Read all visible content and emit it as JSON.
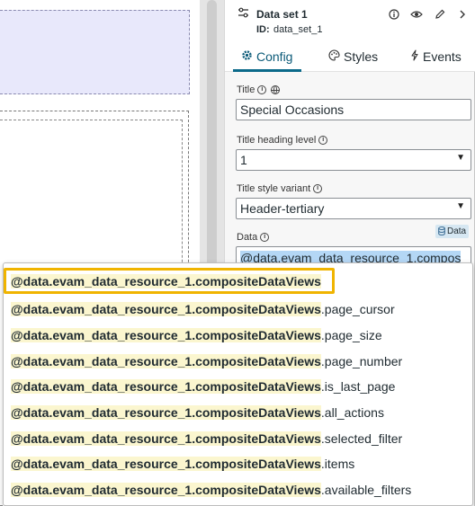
{
  "panel": {
    "header": {
      "title": "Data set 1",
      "id_label": "ID:",
      "id_value": "data_set_1",
      "icons": [
        "sliders-icon",
        "info-icon",
        "eye-icon",
        "pencil-icon",
        "chevron-right-icon"
      ]
    },
    "tabs": [
      {
        "label": "Config",
        "icon": "gear-icon",
        "active": true
      },
      {
        "label": "Styles",
        "icon": "palette-icon",
        "active": false
      },
      {
        "label": "Events",
        "icon": "lightning-icon",
        "active": false
      }
    ],
    "fields": {
      "title_label": "Title",
      "title_value": "Special Occasions",
      "heading_label": "Title heading level",
      "heading_value": "1",
      "style_label": "Title style variant",
      "style_value": "Header-tertiary",
      "data_label": "Data",
      "data_badge": "Data",
      "data_value": "@data.evam_data_resource_1.compos"
    }
  },
  "dropdown": {
    "match_text": "@data.evam_data_resource_1.compositeDataViews",
    "suggestions": [
      {
        "suffix": "",
        "selected": true
      },
      {
        "suffix": ".page_cursor",
        "selected": false
      },
      {
        "suffix": ".page_size",
        "selected": false
      },
      {
        "suffix": ".page_number",
        "selected": false
      },
      {
        "suffix": ".is_last_page",
        "selected": false
      },
      {
        "suffix": ".all_actions",
        "selected": false
      },
      {
        "suffix": ".selected_filter",
        "selected": false
      },
      {
        "suffix": ".items",
        "selected": false
      },
      {
        "suffix": ".available_filters",
        "selected": false
      }
    ]
  },
  "colors": {
    "accent": "#0b6a8a",
    "highlight_border": "#f0b400",
    "match_bg": "#fbf6cf",
    "canvas_block": "#e8e8fb"
  }
}
